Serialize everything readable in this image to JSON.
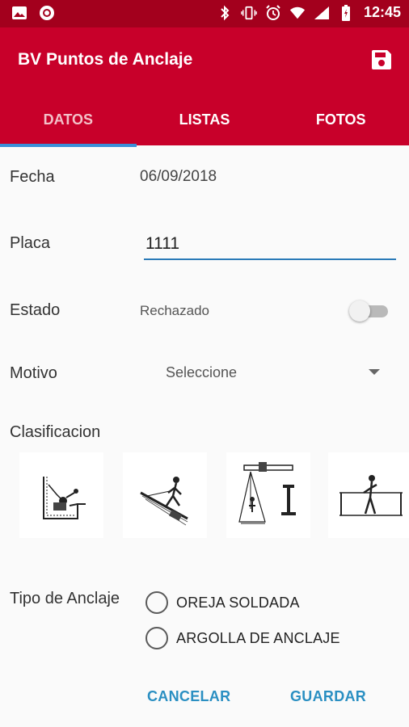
{
  "status_bar": {
    "time": "12:45",
    "left_icons": [
      "image-icon",
      "record-icon"
    ],
    "right_icons": [
      "bluetooth-icon",
      "vibrate-icon",
      "alarm-icon",
      "wifi-icon",
      "signal-icon",
      "battery-icon"
    ]
  },
  "app_bar": {
    "title": "BV Puntos de Anclaje",
    "save_icon": "save-icon"
  },
  "tabs": [
    {
      "label": "DATOS",
      "active": true
    },
    {
      "label": "LISTAS",
      "active": false
    },
    {
      "label": "FOTOS",
      "active": false
    }
  ],
  "form": {
    "fecha_label": "Fecha",
    "fecha_value": "06/09/2018",
    "placa_label": "Placa",
    "placa_value": "1111",
    "estado_label": "Estado",
    "estado_value": "Rechazado",
    "estado_switch_on": false,
    "motivo_label": "Motivo",
    "motivo_selected": "Seleccione",
    "clasificacion_label": "Clasificacion",
    "tipo_label": "Tipo de Anclaje",
    "tipo_options": [
      "OREJA SOLDADA",
      "ARGOLLA DE ANCLAJE"
    ]
  },
  "clasificacion_images": [
    "fall-arrest-corner-image",
    "sloped-roof-worker-image",
    "beam-anchor-image",
    "lifeline-worker-image"
  ],
  "buttons": {
    "cancel": "CANCELAR",
    "save": "GUARDAR"
  },
  "colors": {
    "status_bar": "#a3001d",
    "app_bar": "#c8002a",
    "accent": "#2a8fc2",
    "tab_indicator": "#3a8fd8"
  }
}
